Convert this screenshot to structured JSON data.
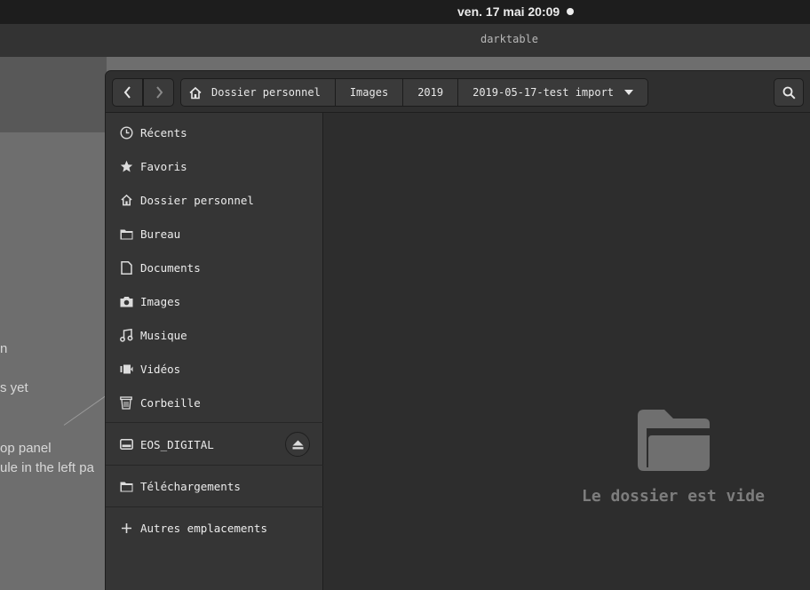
{
  "system": {
    "clock": "ven. 17 mai  20:09"
  },
  "app": {
    "title": "darktable"
  },
  "background": {
    "lines": [
      "n",
      "s yet",
      "op panel",
      "ule in the left pa"
    ]
  },
  "dialog": {
    "breadcrumbs": [
      "Dossier personnel",
      "Images",
      "2019",
      "2019-05-17-test import"
    ],
    "places": [
      {
        "label": "Récents",
        "icon": "clock-icon"
      },
      {
        "label": "Favoris",
        "icon": "star-icon"
      },
      {
        "label": "Dossier personnel",
        "icon": "home-icon"
      },
      {
        "label": "Bureau",
        "icon": "folder-icon"
      },
      {
        "label": "Documents",
        "icon": "document-icon"
      },
      {
        "label": "Images",
        "icon": "camera-icon"
      },
      {
        "label": "Musique",
        "icon": "music-icon"
      },
      {
        "label": "Vidéos",
        "icon": "video-icon"
      },
      {
        "label": "Corbeille",
        "icon": "trash-icon"
      }
    ],
    "devices": [
      {
        "label": "EOS_DIGITAL",
        "icon": "drive-icon"
      }
    ],
    "bookmarks": [
      {
        "label": "Téléchargements",
        "icon": "folder-icon"
      }
    ],
    "other_locations": "Autres emplacements",
    "empty_message": "Le dossier est vide"
  }
}
